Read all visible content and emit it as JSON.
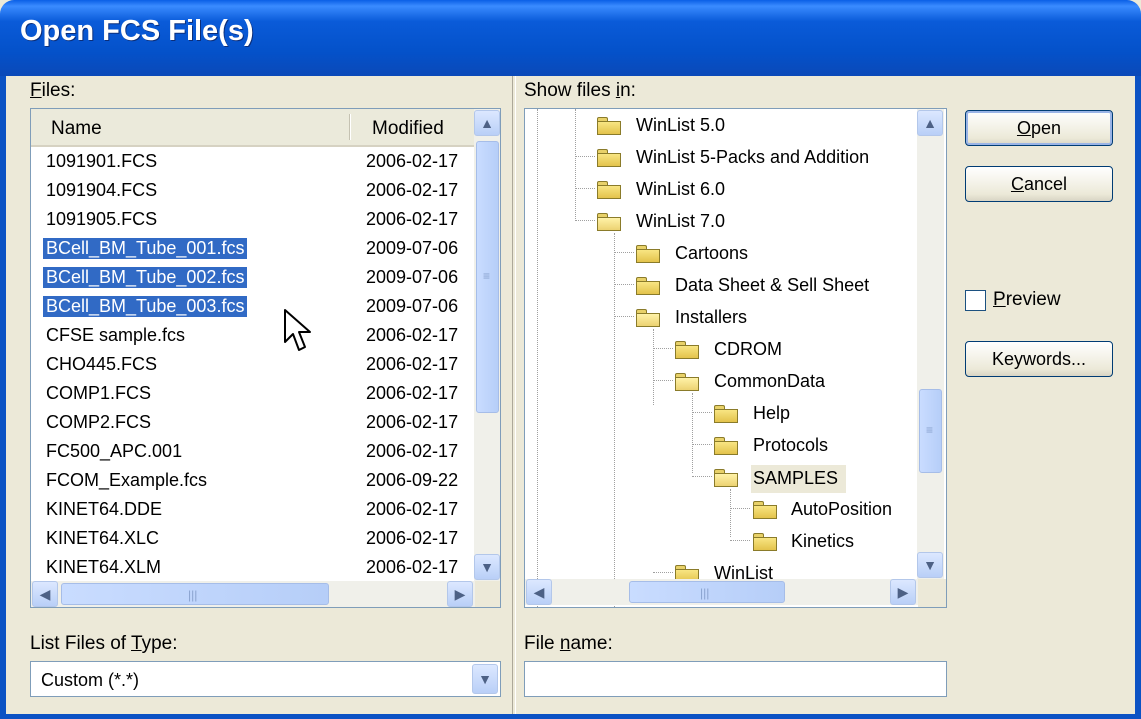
{
  "window": {
    "title": "Open FCS File(s)"
  },
  "files_panel": {
    "label": "Files:",
    "label_accel": "F",
    "label_rest": "iles:",
    "columns": {
      "name": "Name",
      "modified": "Modified"
    },
    "rows": [
      {
        "name": "1091901.FCS",
        "modified": "2006-02-17",
        "selected": false
      },
      {
        "name": "1091904.FCS",
        "modified": "2006-02-17",
        "selected": false
      },
      {
        "name": "1091905.FCS",
        "modified": "2006-02-17",
        "selected": false
      },
      {
        "name": "BCell_BM_Tube_001.fcs",
        "modified": "2009-07-06",
        "selected": true
      },
      {
        "name": "BCell_BM_Tube_002.fcs",
        "modified": "2009-07-06",
        "selected": true
      },
      {
        "name": "BCell_BM_Tube_003.fcs",
        "modified": "2009-07-06",
        "selected": true
      },
      {
        "name": "CFSE sample.fcs",
        "modified": "2006-02-17",
        "selected": false
      },
      {
        "name": "CHO445.FCS",
        "modified": "2006-02-17",
        "selected": false
      },
      {
        "name": "COMP1.FCS",
        "modified": "2006-02-17",
        "selected": false
      },
      {
        "name": "COMP2.FCS",
        "modified": "2006-02-17",
        "selected": false
      },
      {
        "name": "FC500_APC.001",
        "modified": "2006-02-17",
        "selected": false
      },
      {
        "name": "FCOM_Example.fcs",
        "modified": "2006-09-22",
        "selected": false
      },
      {
        "name": "KINET64.DDE",
        "modified": "2006-02-17",
        "selected": false
      },
      {
        "name": "KINET64.XLC",
        "modified": "2006-02-17",
        "selected": false
      },
      {
        "name": "KINET64.XLM",
        "modified": "2006-02-17",
        "selected": false
      }
    ]
  },
  "folders_panel": {
    "label": "Show files in:",
    "label_pre": "Show files ",
    "label_accel": "i",
    "label_post": "n:",
    "nodes": [
      {
        "name": "WinList 5.0",
        "open": false,
        "selected": false
      },
      {
        "name": "WinList 5-Packs and Addition",
        "open": false,
        "selected": false
      },
      {
        "name": "WinList 6.0",
        "open": false,
        "selected": false
      },
      {
        "name": "WinList 7.0",
        "open": true,
        "selected": false
      },
      {
        "name": "Cartoons",
        "open": false,
        "selected": false
      },
      {
        "name": "Data Sheet & Sell Sheet",
        "open": false,
        "selected": false
      },
      {
        "name": "Installers",
        "open": false,
        "selected": false
      },
      {
        "name": "CDROM",
        "open": false,
        "selected": false
      },
      {
        "name": "CommonData",
        "open": true,
        "selected": false
      },
      {
        "name": "Help",
        "open": false,
        "selected": false
      },
      {
        "name": "Protocols",
        "open": false,
        "selected": false
      },
      {
        "name": "SAMPLES",
        "open": true,
        "selected": true
      },
      {
        "name": "AutoPosition",
        "open": false,
        "selected": false
      },
      {
        "name": "Kinetics",
        "open": false,
        "selected": false
      },
      {
        "name": "WinList",
        "open": false,
        "selected": false
      }
    ]
  },
  "buttons": {
    "open": {
      "accel": "O",
      "rest": "pen"
    },
    "cancel": {
      "accel": "C",
      "rest": "ancel"
    },
    "keywords": "Keywords..."
  },
  "preview": {
    "accel": "P",
    "rest": "review",
    "checked": false
  },
  "file_type": {
    "label_pre": "List Files of ",
    "label_accel": "T",
    "label_post": "ype:",
    "value": "Custom (*.*)"
  },
  "file_name": {
    "label_pre": "File ",
    "label_accel": "n",
    "label_post": "ame:",
    "value": ""
  },
  "icons": [
    "folder-icon",
    "scroll-up-icon",
    "scroll-down-icon",
    "scroll-left-icon",
    "scroll-right-icon",
    "dropdown-arrow-icon",
    "mouse-cursor-icon"
  ],
  "colors": {
    "selection": "#316ac5",
    "titlebar": "#0a5bd9",
    "dialog_bg": "#ece9d8"
  }
}
